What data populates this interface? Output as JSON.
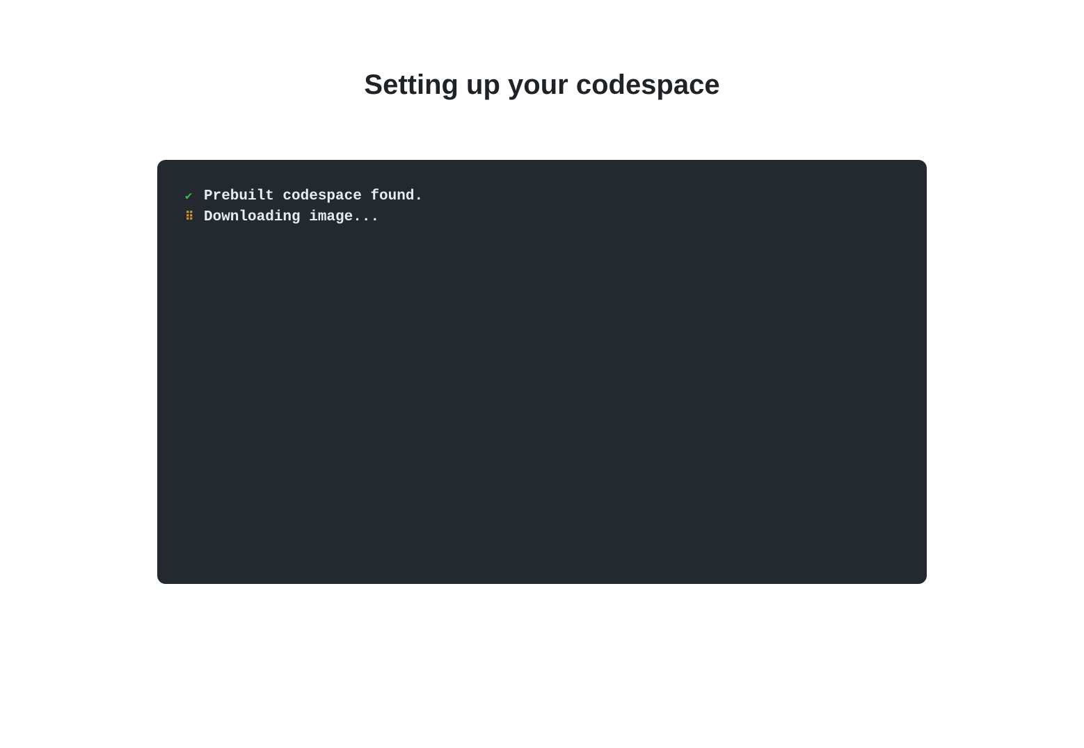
{
  "header": {
    "title": "Setting up your codespace"
  },
  "terminal": {
    "lines": [
      {
        "icon": "check",
        "icon_glyph": "✔",
        "text": "Prebuilt codespace found."
      },
      {
        "icon": "spinner",
        "icon_glyph": "⠿",
        "text": "Downloading image..."
      }
    ]
  },
  "colors": {
    "background": "#ffffff",
    "panel": "#24292f",
    "text": "#e6edf3",
    "success": "#3fb950",
    "progress": "#d29922"
  }
}
